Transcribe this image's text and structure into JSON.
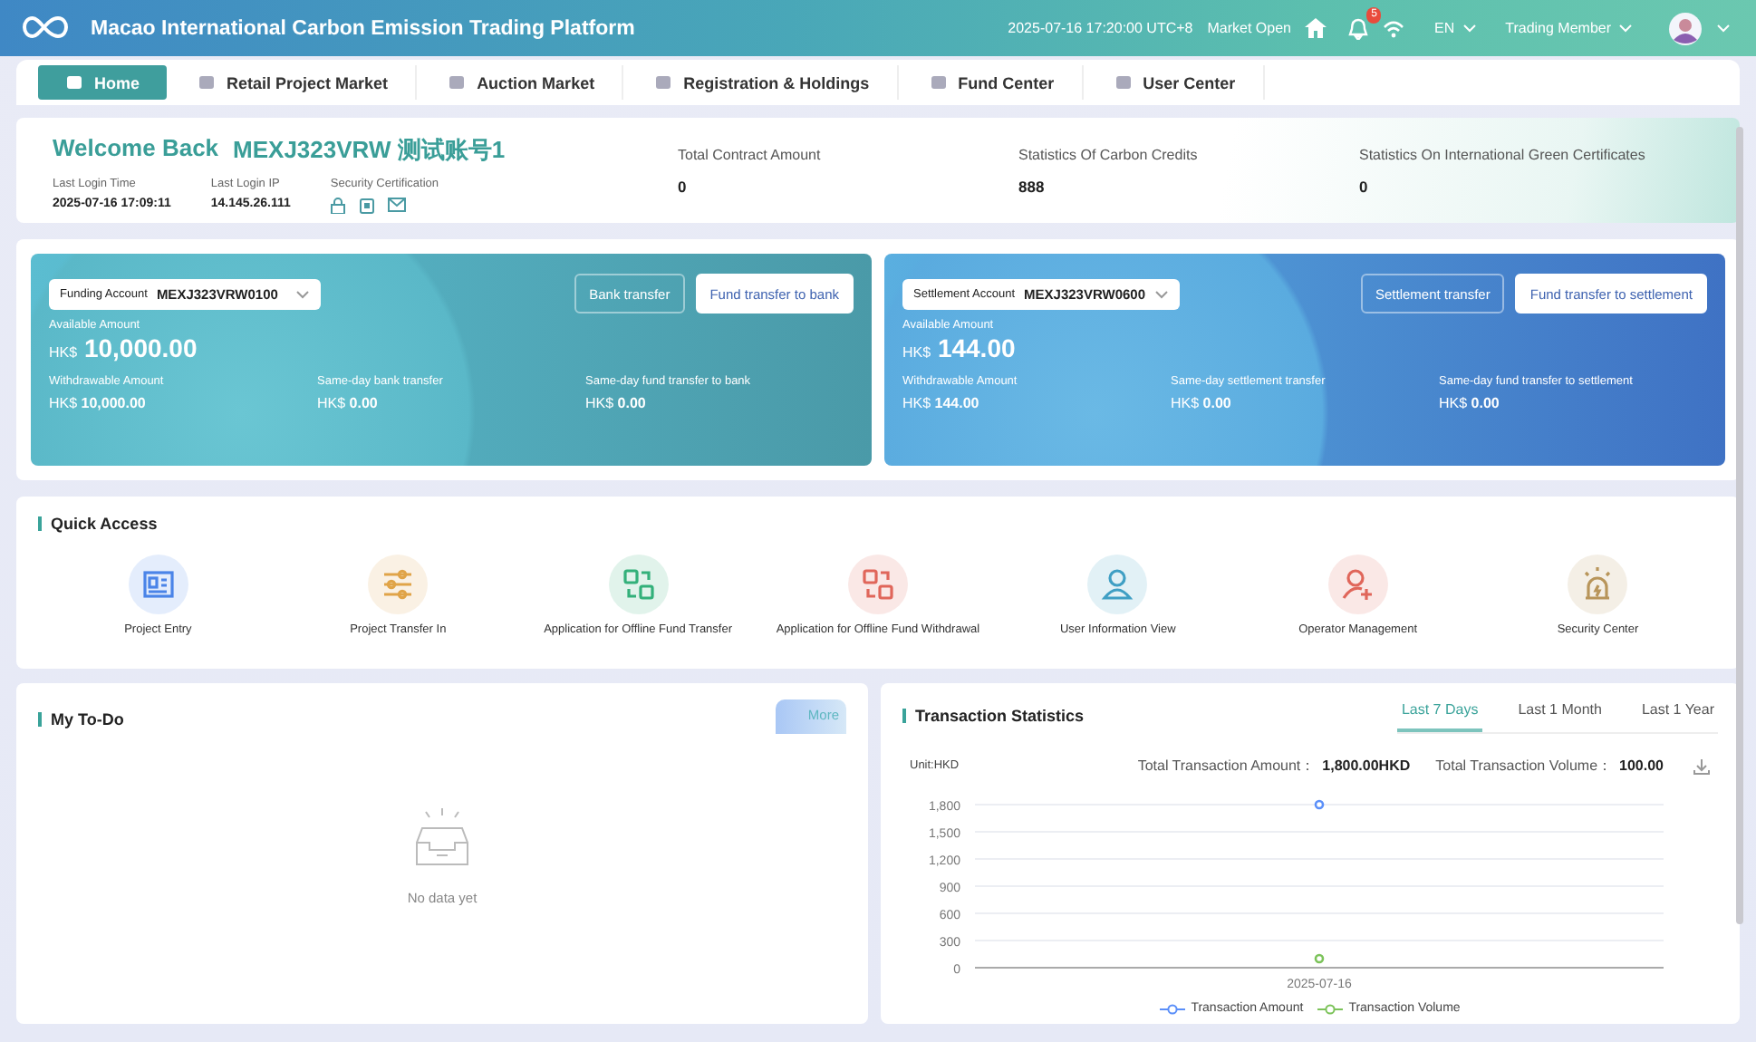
{
  "header": {
    "title": "Macao International Carbon Emission Trading Platform",
    "datetime": "2025-07-16 17:20:00 UTC+8",
    "market_status": "Market Open",
    "notification_count": "5",
    "language": "EN",
    "role": "Trading Member"
  },
  "tabs": [
    {
      "label": "Home",
      "selected": true
    },
    {
      "label": "Retail Project Market",
      "selected": false
    },
    {
      "label": "Auction Market",
      "selected": false
    },
    {
      "label": "Registration & Holdings",
      "selected": false
    },
    {
      "label": "Fund Center",
      "selected": false
    },
    {
      "label": "User Center",
      "selected": false
    }
  ],
  "welcome": {
    "greeting": "Welcome Back",
    "account": "MEXJ323VRW 测试账号1",
    "details": [
      {
        "label": "Last Login Time",
        "value": "2025-07-16 17:09:11"
      },
      {
        "label": "Last Login IP",
        "value": "14.145.26.111"
      }
    ],
    "security_label": "Security Certification",
    "stats": [
      {
        "label": "Total Contract Amount",
        "value": "0"
      },
      {
        "label": "Statistics Of Carbon Credits",
        "value": "888"
      },
      {
        "label": "Statistics On International Green Certificates",
        "value": "0"
      }
    ]
  },
  "accounts": [
    {
      "kind": "funding",
      "select_label": "Funding Account",
      "select_value": "MEXJ323VRW0100",
      "buttons": [
        "Bank transfer",
        "Fund transfer to bank"
      ],
      "available_label": "Available Amount",
      "currency": "HK$",
      "available": "10,000.00",
      "items": [
        {
          "label": "Withdrawable Amount",
          "currency": "HK$",
          "value": "10,000.00"
        },
        {
          "label": "Same-day bank transfer",
          "currency": "HK$",
          "value": "0.00"
        },
        {
          "label": "Same-day fund transfer to bank",
          "currency": "HK$",
          "value": "0.00"
        }
      ]
    },
    {
      "kind": "settlement",
      "select_label": "Settlement Account",
      "select_value": "MEXJ323VRW0600",
      "buttons": [
        "Settlement transfer",
        "Fund transfer to settlement"
      ],
      "available_label": "Available Amount",
      "currency": "HK$",
      "available": "144.00",
      "items": [
        {
          "label": "Withdrawable Amount",
          "currency": "HK$",
          "value": "144.00"
        },
        {
          "label": "Same-day settlement transfer",
          "currency": "HK$",
          "value": "0.00"
        },
        {
          "label": "Same-day fund transfer to settlement",
          "currency": "HK$",
          "value": "0.00"
        }
      ]
    }
  ],
  "quick_access": {
    "title": "Quick Access",
    "items": [
      {
        "label": "Project Entry",
        "color": "#4a84e8"
      },
      {
        "label": "Project Transfer In",
        "color": "#e0a448"
      },
      {
        "label": "Application for Offline Fund Transfer",
        "color": "#33b07a"
      },
      {
        "label": "Application for Offline Fund Withdrawal",
        "color": "#e0665a"
      },
      {
        "label": "User Information View",
        "color": "#3f9fc4"
      },
      {
        "label": "Operator Management",
        "color": "#e0665a"
      },
      {
        "label": "Security Center",
        "color": "#b8955a"
      }
    ]
  },
  "todo": {
    "title": "My To-Do",
    "more": "More",
    "empty": "No data yet"
  },
  "transactions": {
    "title": "Transaction Statistics",
    "periods": [
      {
        "label": "Last 7 Days",
        "selected": true
      },
      {
        "label": "Last 1 Month",
        "selected": false
      },
      {
        "label": "Last 1 Year",
        "selected": false
      }
    ],
    "unit": "Unit:HKD",
    "total_amount_label": "Total Transaction Amount：",
    "total_amount": "1,800.00HKD",
    "total_volume_label": "Total Transaction Volume：",
    "total_volume": "100.00",
    "chart_data": {
      "type": "line",
      "x": [
        "2025-07-16"
      ],
      "yticks": [
        {
          "value": 0,
          "label": "0"
        },
        300,
        600,
        900,
        {
          "value": 1200,
          "label": "1,200"
        },
        {
          "value": 1500,
          "label": "1,500"
        },
        {
          "value": 1800,
          "label": "1,800"
        }
      ],
      "ylim": [
        0,
        1800
      ],
      "grid": true,
      "legend": true,
      "series": [
        {
          "name": "Transaction Amount",
          "color": "#5b8ff9",
          "marker": "circle",
          "values": [
            1800
          ]
        },
        {
          "name": "Transaction Volume",
          "color": "#7cc35a",
          "marker": "circle",
          "values": [
            100
          ]
        }
      ]
    }
  }
}
